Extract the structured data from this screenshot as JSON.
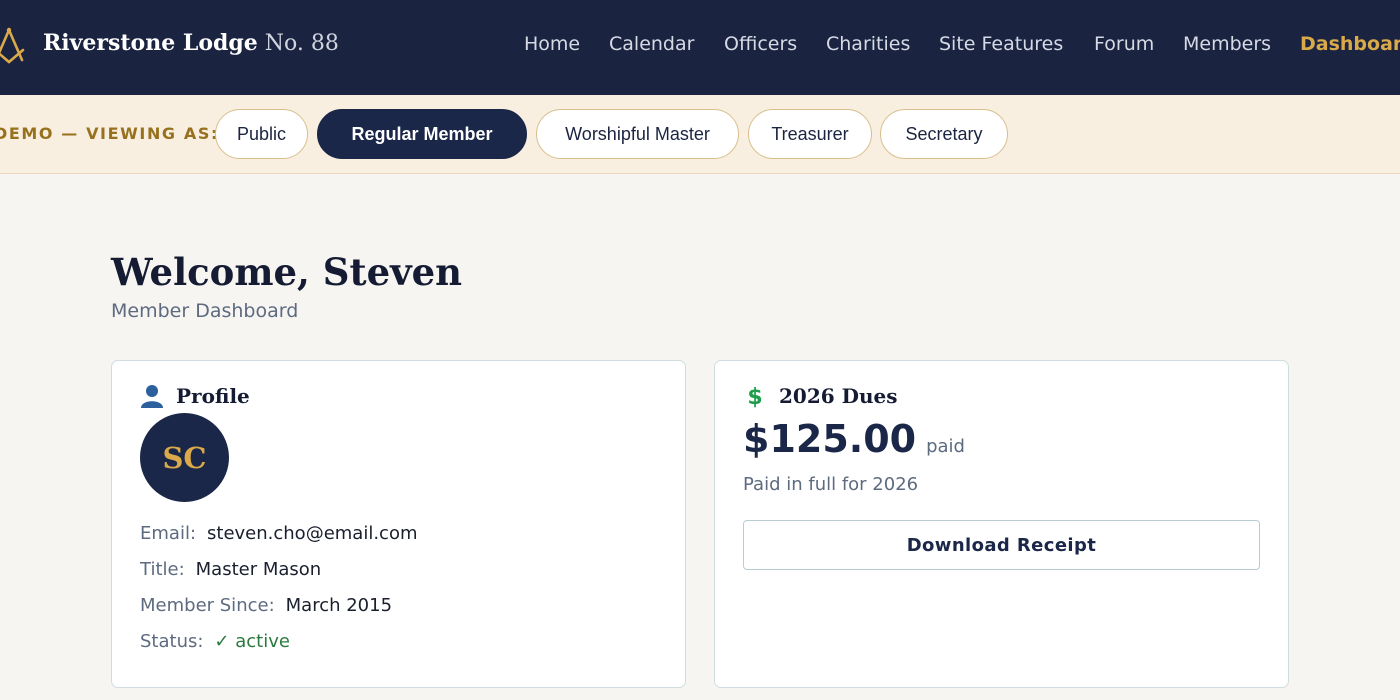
{
  "brand": {
    "name": "Riverstone Lodge",
    "number": "No. 88"
  },
  "nav": {
    "items": [
      {
        "label": "Home"
      },
      {
        "label": "Calendar"
      },
      {
        "label": "Officers"
      },
      {
        "label": "Charities"
      },
      {
        "label": "Site Features"
      },
      {
        "label": "Forum"
      },
      {
        "label": "Members"
      },
      {
        "label": "Dashboard"
      }
    ],
    "active": "Dashboard"
  },
  "demo": {
    "label": "DEMO — VIEWING AS:",
    "roles": [
      {
        "label": "Public"
      },
      {
        "label": "Regular Member"
      },
      {
        "label": "Worshipful Master"
      },
      {
        "label": "Treasurer"
      },
      {
        "label": "Secretary"
      }
    ],
    "active": "Regular Member"
  },
  "page": {
    "title": "Welcome, Steven",
    "subtitle": "Member Dashboard"
  },
  "profile": {
    "heading": "Profile",
    "initials": "SC",
    "email_label": "Email:",
    "email": "steven.cho@email.com",
    "title_label": "Title:",
    "title": "Master Mason",
    "since_label": "Member Since:",
    "since": "March 2015",
    "status_label": "Status:",
    "status": "✓ active"
  },
  "dues": {
    "heading": "2026 Dues",
    "amount": "$125.00",
    "amount_status": "paid",
    "note": "Paid in full for 2026",
    "button_label": "Download Receipt"
  },
  "colors": {
    "navy": "#1a2340",
    "gold": "#d9a94a",
    "cream": "#f8efe0",
    "success": "#2a7a3e",
    "dollar_icon": "#1e9e4a"
  },
  "icons": {
    "logo": "square-compass-icon",
    "profile": "person-icon",
    "dues": "dollar-icon"
  }
}
